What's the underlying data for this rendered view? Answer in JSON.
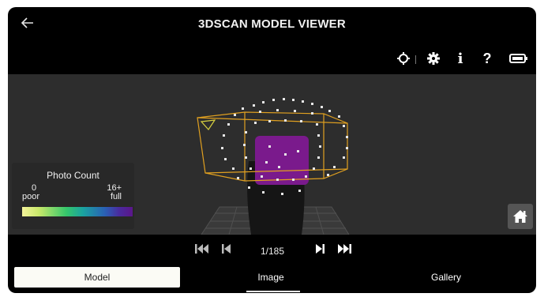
{
  "header": {
    "title": "3DSCAN MODEL VIEWER",
    "back_icon": "arrow-left-icon"
  },
  "toolbar": {
    "icons": [
      "crosshair-icon",
      "gear-icon",
      "info-icon",
      "help-icon",
      "battery-icon"
    ],
    "info_glyph": "i",
    "help_glyph": "?"
  },
  "legend": {
    "title": "Photo Count",
    "min_value": "0",
    "min_label": "poor",
    "max_value": "16+",
    "max_label": "full",
    "gradient_colors": [
      "#f4f39b",
      "#c9e86a",
      "#35c76b",
      "#1aa3a0",
      "#2a60b5",
      "#4a2a9e",
      "#5b168a"
    ]
  },
  "viewport": {
    "home_icon": "home-icon",
    "bbox_color": "#e0a020",
    "mesh_color": "#7a1a8c"
  },
  "playback": {
    "counter": "1/185",
    "controls": [
      "skip-to-start-icon",
      "step-back-icon",
      "step-forward-icon",
      "skip-to-end-icon"
    ]
  },
  "tabs": [
    {
      "label": "Model",
      "selected": true
    },
    {
      "label": "Image",
      "selected": false
    },
    {
      "label": "Gallery",
      "selected": false
    }
  ]
}
